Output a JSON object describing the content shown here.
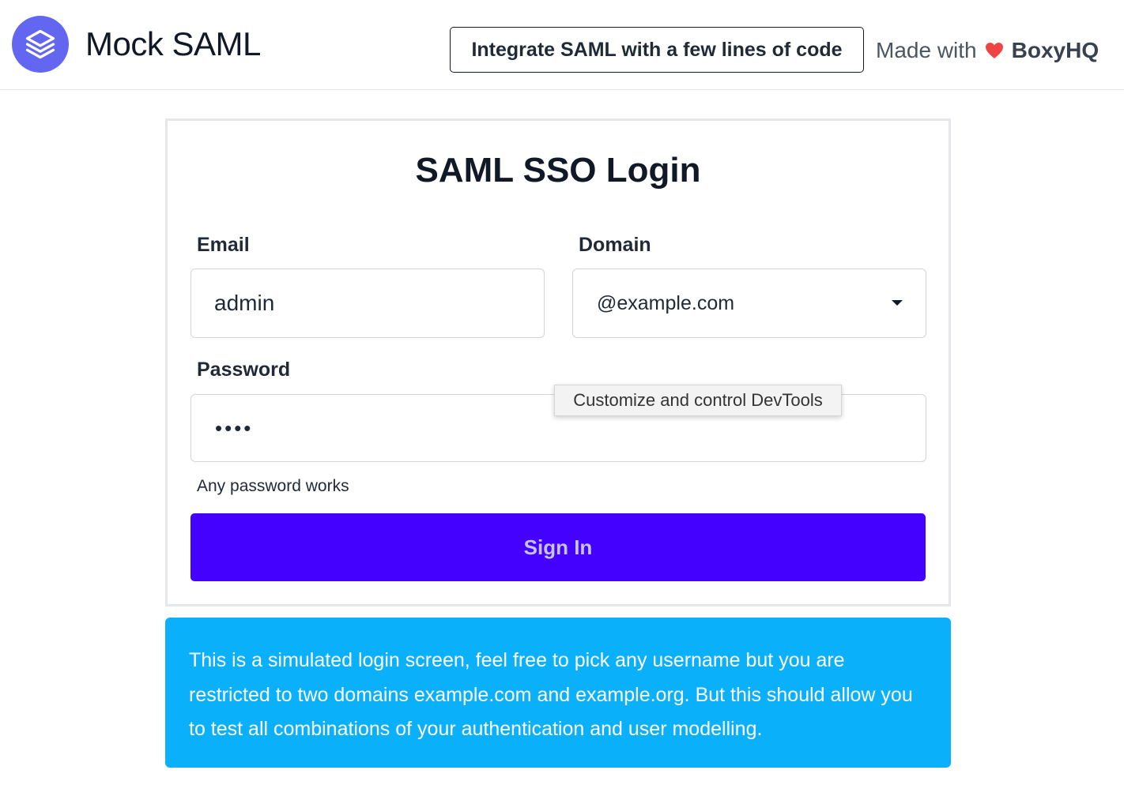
{
  "header": {
    "app_title": "Mock SAML",
    "integrate_button": "Integrate SAML with a few lines of code",
    "made_with_text": "Made with",
    "brand_name": "BoxyHQ",
    "logo_icon": "layers-icon",
    "heart_icon": "heart-icon",
    "heart_color": "#ef4444",
    "logo_color": "#6366f1"
  },
  "login": {
    "title": "SAML SSO Login",
    "email_label": "Email",
    "email_value": "admin",
    "domain_label": "Domain",
    "domain_value": "@example.com",
    "password_label": "Password",
    "password_value": "••••",
    "password_helper": "Any password works",
    "signin_button": "Sign In",
    "signin_color": "#4401fe"
  },
  "tooltip": {
    "text": "Customize and control DevTools"
  },
  "info": {
    "text": "This is a simulated login screen, feel free to pick any username but you are restricted to two domains example.com and example.org. But this should allow you to test all combinations of your authentication and user modelling.",
    "background": "#0bb0fb"
  }
}
